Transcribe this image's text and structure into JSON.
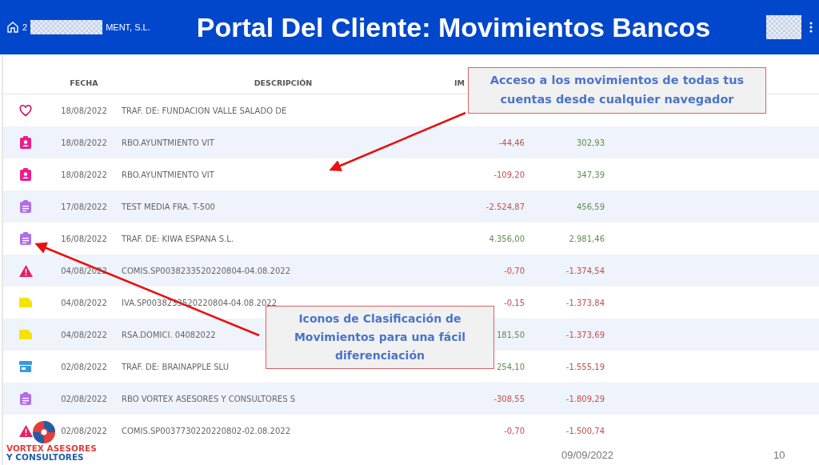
{
  "header": {
    "company_start": "2",
    "company_end": "MENT, S.L.",
    "title": "Portal Del Cliente: Movimientos Bancos"
  },
  "table": {
    "columns": [
      "FECHA",
      "DESCRIPCIÓN",
      "IM"
    ],
    "rows": [
      {
        "kind": "heart",
        "date": "18/08/2022",
        "description": "TRAF. DE: FUNDACION VALLE SALADO DE"
      },
      {
        "kind": "badge",
        "date": "18/08/2022",
        "description": "RBO.AYUNTMIENTO VIT",
        "amount": {
          "text": "-44,46",
          "color": "#c0504d"
        },
        "balance": {
          "text": "302,93",
          "color": "#5a8f4a"
        }
      },
      {
        "kind": "badge",
        "date": "18/08/2022",
        "description": "RBO.AYUNTMIENTO VIT",
        "amount": {
          "text": "-109,20",
          "color": "#c0504d"
        },
        "balance": {
          "text": "347,39",
          "color": "#5a8f4a"
        }
      },
      {
        "kind": "clipboard",
        "date": "17/08/2022",
        "description": "TEST MEDIA FRA. T-500",
        "amount": {
          "text": "-2.524,87",
          "color": "#c0504d"
        },
        "balance": {
          "text": "456,59",
          "color": "#5a8f4a"
        }
      },
      {
        "kind": "clipboard",
        "date": "16/08/2022",
        "description": "TRAF. DE: KIWA ESPANA S.L.",
        "amount": {
          "text": "4.356,00",
          "color": "#5a8f4a"
        },
        "balance": {
          "text": "2.981,46",
          "color": "#5a8f4a"
        }
      },
      {
        "kind": "warning",
        "date": "04/08/2022",
        "description": "COMIS.SP0038233520220804-04.08.2022",
        "amount": {
          "text": "-0,70",
          "color": "#c0504d"
        },
        "balance": {
          "text": "-1.374,54",
          "color": "#c0504d"
        }
      },
      {
        "kind": "note",
        "date": "04/08/2022",
        "description": "IVA.SP0038233520220804-04.08.2022",
        "amount": {
          "text": "-0,15",
          "color": "#c0504d"
        },
        "balance": {
          "text": "-1.373,84",
          "color": "#c0504d"
        }
      },
      {
        "kind": "note",
        "date": "04/08/2022",
        "description": "RSA.DOMICI. 04082022",
        "amount": {
          "text": "181,50",
          "color": "#5a8f4a"
        },
        "balance": {
          "text": "-1.373,69",
          "color": "#c0504d"
        }
      },
      {
        "kind": "store",
        "date": "02/08/2022",
        "description": "TRAF. DE: BRAINAPPLE SLU",
        "amount": {
          "text": "254,10",
          "color": "#5a8f4a"
        },
        "balance": {
          "text": "-1.555,19",
          "color": "#c0504d"
        }
      },
      {
        "kind": "clipboard",
        "date": "02/08/2022",
        "description": "RBO VORTEX ASESORES Y CONSULTORES S",
        "amount": {
          "text": "-308,55",
          "color": "#c0504d"
        },
        "balance": {
          "text": "-1.809,29",
          "color": "#c0504d"
        }
      },
      {
        "kind": "warning",
        "date": "02/08/2022",
        "description": "COMIS.SP0037730220220802-02.08.2022",
        "amount": {
          "text": "-0,70",
          "color": "#c0504d"
        },
        "balance": {
          "text": "-1.500,74",
          "color": "#c0504d"
        }
      }
    ]
  },
  "callouts": [
    "Acceso a los movimientos de todas tus cuentas desde cualquier navegador",
    "Iconos de Clasificación de Movimientos para una fácil diferenciación"
  ],
  "footer": {
    "date": "09/09/2022",
    "page": "10"
  },
  "logo": {
    "line_1": "VORTEX ASESORES",
    "line_2": "Y CONSULTORES"
  }
}
